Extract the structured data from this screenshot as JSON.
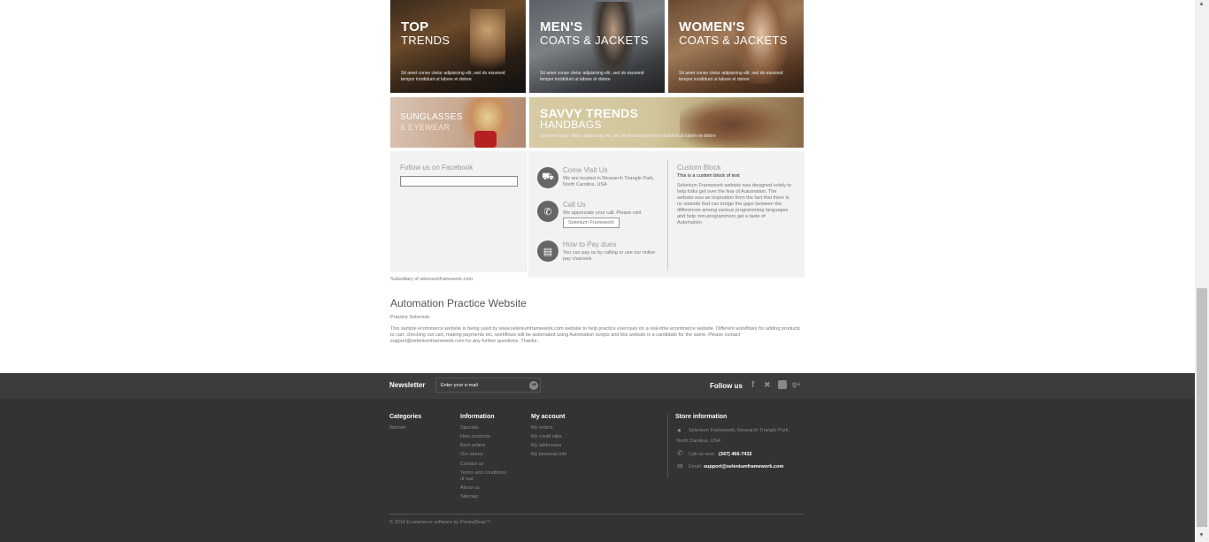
{
  "banners": [
    {
      "line1": "TOP",
      "line2": "TRENDS",
      "desc": "Sit amet conse ctetur adipisicing elit, sed do eiusmod tempor incididunt ut labore et dolore"
    },
    {
      "line1": "MEN'S",
      "line2": "COATS & JACKETS",
      "desc": "Sit amet conse ctetur adipisicing elit, sed do eiusmod tempor incididunt ut labore et dolore"
    },
    {
      "line1": "WOMEN'S",
      "line2": "COATS & JACKETS",
      "desc": "Sit amet conse ctetur adipisicing elit, sed do eiusmod tempor incididunt ut labore et dolore"
    },
    {
      "line1": "SUNGLASSES",
      "line2": "& EYEWEAR",
      "desc": ""
    },
    {
      "line1": "SAVVY TRENDS",
      "line2": "HANDBAGS",
      "desc": "Sit amet conse ctetur adipisicing elit, sed do eiusmod tempor incididunt ut labore et dolore"
    }
  ],
  "facebook": {
    "title": "Follow us on Facebook"
  },
  "contact": {
    "visit_title": "Come Visit Us",
    "visit_text": "We are located in Research Triangle Park, North Carolina, USA",
    "call_title": "Call Us",
    "call_text": "We appreciate your call. Please visit",
    "call_button": "Selenium Framework",
    "pay_title": "How to Pay dues",
    "pay_text": "You can pay us by calling or use our online pay channels"
  },
  "custom_block": {
    "title": "Custom Block",
    "subtitle": "This is a custom block of text",
    "text": "Selenium Framework website was designed solely to help folks get over the fear of Automation. The website was an inspiration from the fact that there is no website that can bridge the gaps between the differences among various programming languages and help non-programmers get a taste of Automation."
  },
  "subsidiary": "Subsidiary of seleniumframework.com",
  "about": {
    "title": "Automation Practice Website",
    "subtitle": "Practice Selenium",
    "text": "This sample ecommerce website is being used by www.seleniumframework.com website to help practice exercises on a real-time ecommerce website. Different workflows for adding products to cart, checking out cart, making payments etc. workflows will be automated using Automation scripts and this website is a candidate for the same. Please contact support@seleniumframework.com for any further questions. Thanks."
  },
  "newsletter": {
    "label": "Newsletter",
    "placeholder": "Enter your e-mail"
  },
  "follow": {
    "label": "Follow us"
  },
  "footer": {
    "categories": {
      "title": "Categories",
      "items": [
        "Women"
      ]
    },
    "information": {
      "title": "Information",
      "items": [
        "Specials",
        "New products",
        "Best sellers",
        "Our stores",
        "Contact us",
        "Terms and conditions",
        "of use",
        "About us",
        "Sitemap"
      ]
    },
    "account": {
      "title": "My account",
      "items": [
        "My orders",
        "My credit slips",
        "My addresses",
        "My personal info"
      ]
    },
    "store": {
      "title": "Store information",
      "address": "Selenium Framework, Research Triangle Park,",
      "address2": "North Carolina, USA",
      "call_label": "Call us now:",
      "phone": "(347) 466-7432",
      "email_label": "Email:",
      "email": "support@seleniumframework.com"
    },
    "copyright": "© 2014 Ecommerce software by PrestaShop™"
  },
  "colors": {
    "footer_bg": "#333333",
    "newsletter_bg": "#3c3c3c",
    "panel_bg": "#f2f2f2"
  }
}
